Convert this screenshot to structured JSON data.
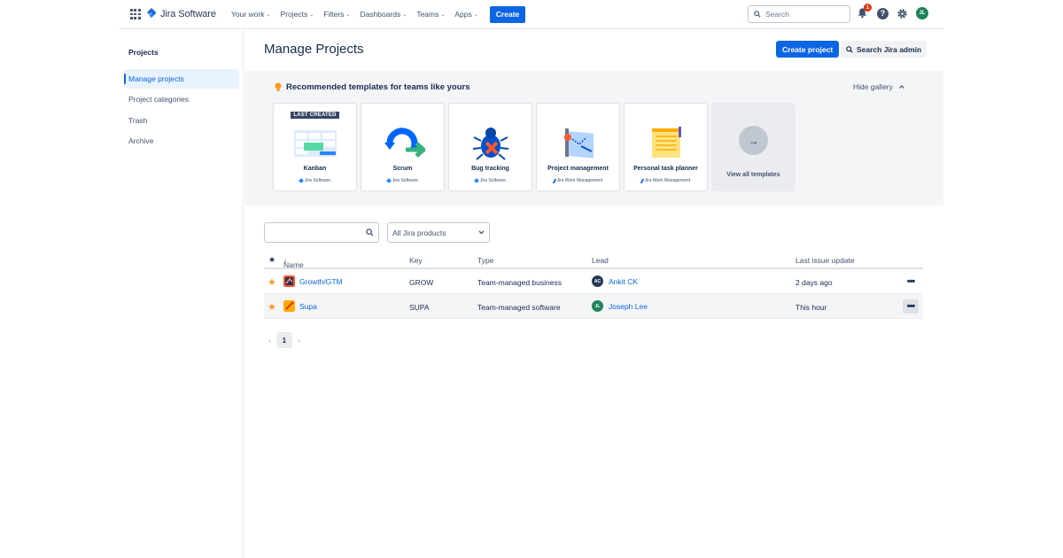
{
  "topnav": {
    "logo": "Jira Software",
    "items": [
      {
        "label": "Your work"
      },
      {
        "label": "Projects"
      },
      {
        "label": "Filters"
      },
      {
        "label": "Dashboards"
      },
      {
        "label": "Teams"
      },
      {
        "label": "Apps"
      }
    ],
    "create_label": "Create",
    "search_placeholder": "Search",
    "notification_count": "1",
    "user_initials": "JL"
  },
  "sidebar": {
    "title": "Projects",
    "items": [
      {
        "label": "Manage projects",
        "active": true
      },
      {
        "label": "Project categories"
      },
      {
        "label": "Trash"
      },
      {
        "label": "Archive"
      }
    ]
  },
  "header": {
    "title": "Manage Projects",
    "create_project": "Create project",
    "search_admin": "Search Jira admin"
  },
  "gallery": {
    "title": "Recommended templates for teams like yours",
    "hide_label": "Hide gallery",
    "cards": [
      {
        "name": "Kanban",
        "tag": "LAST CREATED",
        "product": "Jira Software"
      },
      {
        "name": "Scrum",
        "product": "Jira Software"
      },
      {
        "name": "Bug tracking",
        "product": "Jira Software"
      },
      {
        "name": "Project management",
        "product": "Jira Work Management"
      },
      {
        "name": "Personal task planner",
        "product": "Jira Work Management"
      }
    ],
    "view_all": "View all templates"
  },
  "filters": {
    "search_value": "",
    "product_select": "All Jira products"
  },
  "table": {
    "headers": {
      "name": "Name",
      "key": "Key",
      "type": "Type",
      "lead": "Lead",
      "last_update": "Last issue update"
    },
    "rows": [
      {
        "name": "Growth/GTM",
        "key": "GROW",
        "type": "Team-managed business",
        "lead": "Ankit CK",
        "lead_initials": "AC",
        "lead_color": "#253858",
        "last_update": "2 days ago"
      },
      {
        "name": "Supa",
        "key": "SUPA",
        "type": "Team-managed software",
        "lead": "Joseph Lee",
        "lead_initials": "JL",
        "lead_color": "#1f845a",
        "last_update": "This hour"
      }
    ]
  },
  "pagination": {
    "current": "1"
  }
}
